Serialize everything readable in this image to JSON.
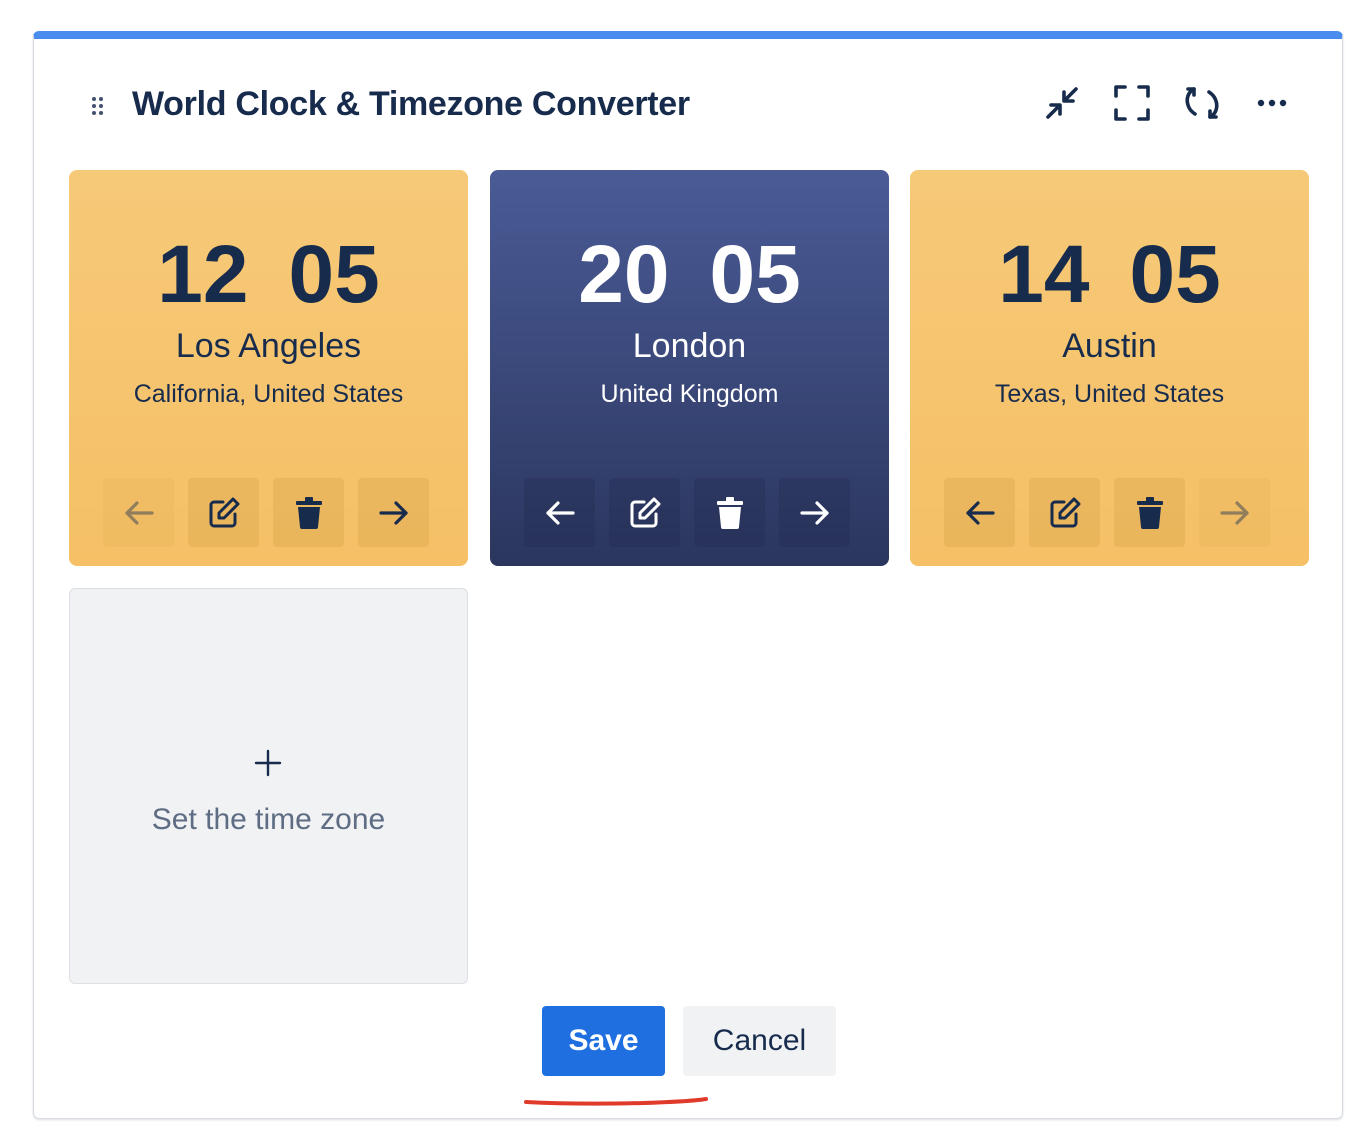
{
  "widget": {
    "title": "World Clock & Timezone Converter",
    "accent_color": "#4b8def",
    "header_icons": [
      "collapse-icon",
      "fullscreen-icon",
      "refresh-icon",
      "more-icon"
    ]
  },
  "clocks": [
    {
      "hours": "12",
      "minutes": "05",
      "city": "Los Angeles",
      "region": "California, United States",
      "theme": "yellow",
      "prev_enabled": false,
      "next_enabled": true
    },
    {
      "hours": "20",
      "minutes": "05",
      "city": "London",
      "region": "United Kingdom",
      "theme": "navy",
      "prev_enabled": true,
      "next_enabled": true
    },
    {
      "hours": "14",
      "minutes": "05",
      "city": "Austin",
      "region": "Texas, United States",
      "theme": "yellow",
      "prev_enabled": true,
      "next_enabled": false
    }
  ],
  "add_card": {
    "label": "Set the time zone"
  },
  "footer": {
    "save_label": "Save",
    "cancel_label": "Cancel"
  },
  "colors": {
    "yellow_card": "#f6c978",
    "navy_card": "#3a4a7e",
    "primary_button": "#1f6fe0",
    "annotation": "#e03a2b"
  }
}
